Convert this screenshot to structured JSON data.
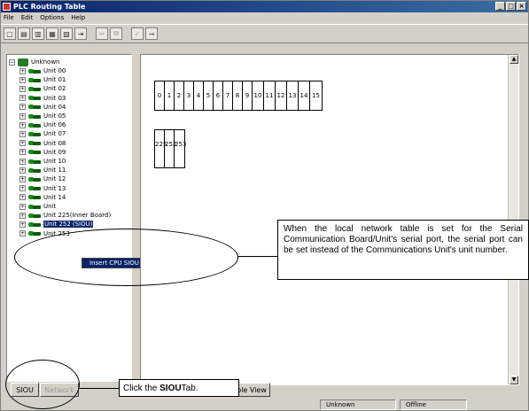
{
  "window": {
    "title": "PLC Routing Table",
    "controls": [
      "_",
      "□",
      "×"
    ]
  },
  "menu": [
    "File",
    "Edit",
    "Options",
    "Help"
  ],
  "toolbar": {
    "buttons": [
      {
        "icon": "new-icon",
        "glyph": "▢"
      },
      {
        "icon": "open-icon",
        "glyph": "▤"
      },
      {
        "icon": "save-icon",
        "glyph": "▥"
      },
      {
        "icon": "print-icon",
        "glyph": "▦"
      },
      {
        "icon": "preview-icon",
        "glyph": "▧"
      },
      {
        "icon": "transfer-icon",
        "glyph": "⇥"
      },
      {
        "icon": "cut-icon",
        "glyph": "✂"
      },
      {
        "icon": "copy-icon",
        "glyph": "⧉"
      },
      {
        "icon": "check-icon",
        "glyph": "✓"
      },
      {
        "icon": "connect-icon",
        "glyph": "⊸"
      }
    ]
  },
  "tree": {
    "root": "Unknown",
    "units": [
      "Unit 00",
      "Unit 01",
      "Unit 02",
      "Unit 03",
      "Unit 04",
      "Unit 05",
      "Unit 06",
      "Unit 07",
      "Unit 08",
      "Unit 09",
      "Unit 10",
      "Unit 11",
      "Unit 12",
      "Unit 13",
      "Unit 14",
      "Unit",
      "Unit 225(Inner Board)",
      "Unit 252",
      "Unit 253"
    ],
    "selected_unit_suffix": "(SIOU)"
  },
  "context_menu": {
    "item": "Insert CPU SIOU"
  },
  "grid": {
    "unit_numbers": [
      "0",
      "1",
      "2",
      "3",
      "4",
      "5",
      "6",
      "7",
      "8",
      "9",
      "10",
      "11",
      "12",
      "13",
      "14",
      "15"
    ],
    "board_numbers": [
      "225",
      "252",
      "253"
    ]
  },
  "callouts": {
    "network_note": "When the local network table is set for the Serial Communication Board/Unit's serial port, the serial port can be set instead of the Communications Unit's unit number.",
    "tab_note_prefix": "Click the ",
    "tab_note_bold": "SIOU",
    "tab_note_suffix": " Tab."
  },
  "tabs": {
    "siou": "SIOU",
    "second": "Network",
    "table_view": "ble View"
  },
  "status": {
    "left": "Unknown",
    "right": "Offline"
  }
}
